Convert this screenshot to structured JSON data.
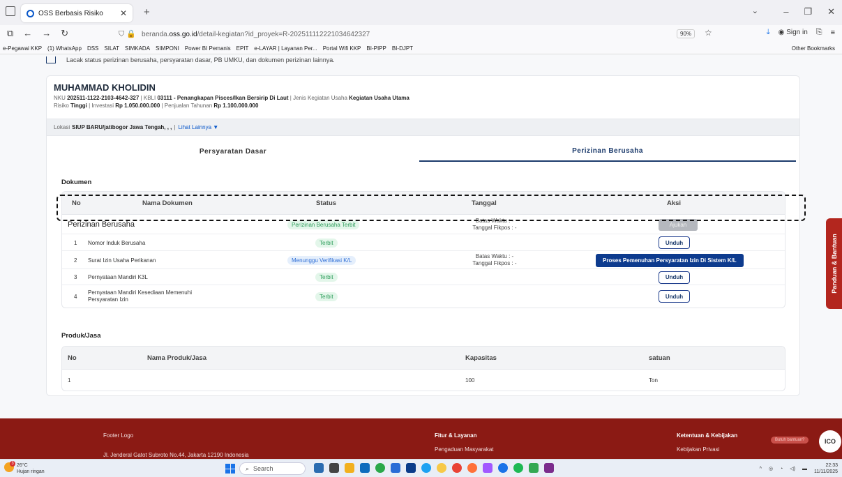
{
  "browser": {
    "tab_title": "OSS Berbasis Risiko",
    "url_prefix": "beranda.",
    "url_domain": "oss.go.id",
    "url_path": "/detail-kegiatan?id_proyek=R-202511112221034642327",
    "zoom": "90%",
    "sign_in": "Sign in",
    "bookmarks": [
      "e-Pegawai KKP",
      "(1) WhatsApp",
      "DSS",
      "SILAT",
      "SIMKADA",
      "SIMPONI",
      "Power BI Pemanis",
      "EPIT",
      "e-LAYAR | Layanan Per...",
      "Portal Wifi KKP",
      "BI-PIPP",
      "BI-DJPT"
    ],
    "other_bookmarks": "Other Bookmarks"
  },
  "page": {
    "track_text": "Lacak status perizinan berusaha, persyaratan dasar, PB UMKU, dan dokumen perizinan lainnya.",
    "name": "MUHAMMAD KHOLIDIN",
    "meta": {
      "nku_label": "NKU",
      "nku": "202511-1122-2103-4642-327",
      "kbli_label": "KBLI",
      "kbli": "03111 - Penangkapan Pisces/Ikan Bersirip Di Laut",
      "jenis_label": "Jenis Kegiatan Usaha",
      "jenis": "Kegiatan Usaha Utama",
      "risiko_label": "Risiko",
      "risiko": "Tinggi",
      "investasi_label": "Investasi",
      "investasi": "Rp 1.050.000.000",
      "penjualan_label": "Penjualan Tahunan",
      "penjualan": "Rp 1.100.000.000"
    },
    "lokasi_label": "Lokasi",
    "lokasi": "SIUP BARU/jatibogor Jawa Tengah, , ,",
    "lihat_lainnya": "Lihat Lainnya ▼",
    "tabs": [
      "Persyaratan Dasar",
      "Perizinan Berusaha"
    ],
    "dokumen": {
      "title": "Dokumen",
      "headers": [
        "No",
        "Nama Dokumen",
        "Status",
        "Tanggal",
        "Aksi"
      ],
      "group": {
        "name": "Perizinan Berusaha",
        "status": "Perizinan Berusaha Terbit",
        "batas": "Batas Waktu : -",
        "fikpos": "Tanggal Fikpos : -",
        "action": "Ajukan"
      },
      "rows": [
        {
          "no": "1",
          "name": "Nomor Induk Berusaha",
          "status": "Terbit",
          "action": "Unduh"
        },
        {
          "no": "2",
          "name": "Surat Izin Usaha Perikanan",
          "status": "Menunggu Verifikasi K/L",
          "batas": "Batas Waktu : -",
          "fikpos": "Tanggal Fikpos : -",
          "action": "Proses Pemenuhan Persyaratan Izin Di Sistem K/L"
        },
        {
          "no": "3",
          "name": "Pernyataan Mandiri K3L",
          "status": "Terbit",
          "action": "Unduh"
        },
        {
          "no": "4",
          "name_line1": "Pernyataan Mandiri Kesediaan Memenuhi",
          "name_line2": "Persyaratan Izin",
          "status": "Terbit",
          "action": "Unduh"
        }
      ]
    },
    "produk": {
      "title": "Produk/Jasa",
      "headers": [
        "No",
        "Nama Produk/Jasa",
        "Kapasitas",
        "satuan"
      ],
      "rows": [
        {
          "no": "1",
          "name": "",
          "kapasitas": "100",
          "satuan": "Ton"
        }
      ]
    },
    "side_tab": "Panduan & Bantuan"
  },
  "footer": {
    "logo": "Footer Logo",
    "address": "Jl. Jenderal Gatot Subroto No.44, Jakarta 12190 Indonesia",
    "col2_title": "Fitur & Layanan",
    "col2_item": "Pengaduan Masyarakat",
    "col3_title": "Ketentuan & Kebijakan",
    "col3_item": "Kebijakan Privasi",
    "help": "Butuh bantuan?",
    "ico": "ICO"
  },
  "taskbar": {
    "temp": "26°C",
    "weather": "Hujan ringan",
    "badge": "3",
    "search": "Search",
    "time": "22:33",
    "date": "11/11/2025"
  }
}
